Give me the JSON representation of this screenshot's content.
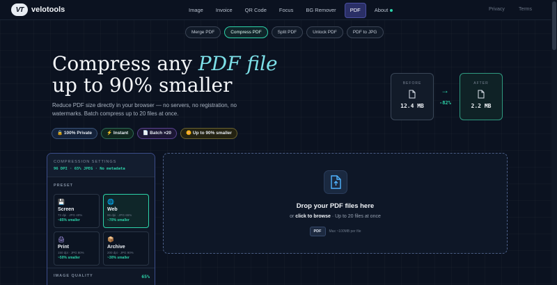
{
  "brand": {
    "name": "velotools",
    "mark": "VT"
  },
  "nav": {
    "links": [
      "Image",
      "Invoice",
      "QR Code",
      "Focus",
      "BG Remover",
      "PDF",
      "About"
    ],
    "active": "PDF",
    "right": [
      "Privacy",
      "Terms"
    ]
  },
  "subtabs": [
    "Merge PDF",
    "Compress PDF",
    "Split PDF",
    "Unlock PDF",
    "PDF to JPG"
  ],
  "hero": {
    "title_pre": "Compress any ",
    "title_em": "PDF file",
    "title_line2": "up to 90% smaller",
    "desc": "Reduce PDF size directly in your browser — no servers, no registration, no watermarks. Batch compress up to 20 files at once.",
    "badges": [
      "🔒 100% Private",
      "⚡ Instant",
      "📄 Batch ×20",
      "🌼 Up to 90% smaller"
    ]
  },
  "comparison": {
    "before_label": "BEFORE",
    "before_value": "12.4 MB",
    "after_label": "AFTER",
    "after_value": "2.2 MB",
    "reduction": "-82%"
  },
  "settings": {
    "title": "COMPRESSION SETTINGS",
    "summary": "96 DPI · 65% JPEG · No metadata",
    "preset_label": "PRESET",
    "presets": [
      {
        "icon": "💾",
        "name": "Screen",
        "spec": "72 dpi · JPG 40%",
        "save": "~85% smaller"
      },
      {
        "icon": "🌐",
        "name": "Web",
        "spec": "96 dpi · JPG 65%",
        "save": "~70% smaller"
      },
      {
        "icon": "🖨",
        "name": "Print",
        "spec": "150 dpi · JPG 80%",
        "save": "~50% smaller"
      },
      {
        "icon": "📦",
        "name": "Archive",
        "spec": "200 dpi · JPG 90%",
        "save": "~30% smaller"
      }
    ],
    "active_preset": "Web",
    "image_quality_label": "IMAGE QUALITY",
    "image_quality_value": "65%"
  },
  "dropzone": {
    "title": "Drop your PDF files here",
    "sub_pre": "or ",
    "sub_link": "click to browse",
    "sub_post": " · Up to 20 files at once",
    "chip": "PDF",
    "max": "Max ~100MB per file"
  },
  "colors": {
    "accent": "#2dd4aa",
    "brand_active": "#2a2f66",
    "hero_em": "#7de0e8"
  }
}
